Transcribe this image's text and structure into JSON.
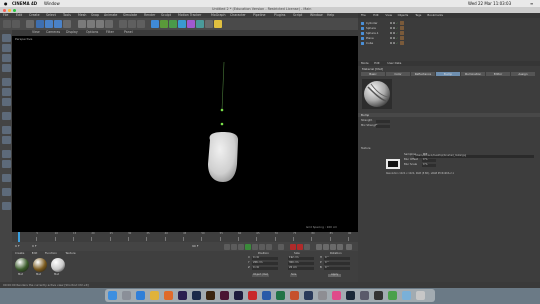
{
  "mac_menubar": {
    "app_name": "CINEMA 4D",
    "menu": "Window",
    "clock": "Wed 22 Mar 11:03:03"
  },
  "window": {
    "title": "Untitled 2 * (Education Version - Restricted License) - Main"
  },
  "app_menu": [
    "File",
    "Edit",
    "Create",
    "Select",
    "Tools",
    "Mesh",
    "Snap",
    "Animate",
    "Simulate",
    "Render",
    "Sculpt",
    "Motion Tracker",
    "MoGraph",
    "Character",
    "Pipeline",
    "Plugins",
    "Script",
    "Window",
    "Help"
  ],
  "layout": {
    "label": "Layout:",
    "value": "Startup (User)"
  },
  "viewport": {
    "menus": [
      "View",
      "Cameras",
      "Display",
      "Options",
      "Filter",
      "Panel"
    ],
    "label": "Perspective",
    "grid_spacing": "Grid Spacing : 100 cm"
  },
  "tooltip": {
    "title": "Render View",
    "line1": "Renders the currently active view",
    "line2": "(Shortcut Ctrl+R)"
  },
  "timeline": {
    "ticks": [
      "0",
      "5",
      "10",
      "15",
      "20",
      "25",
      "30",
      "35",
      "40",
      "45",
      "50",
      "55",
      "60",
      "65",
      "70",
      "75",
      "80",
      "85",
      "90"
    ],
    "frame_start": "0 F",
    "frame_end": "90 F",
    "current": "0 F"
  },
  "material_manager": {
    "menus": [
      "Create",
      "Edit",
      "Function",
      "Texture"
    ],
    "materials": [
      {
        "name": "Mat",
        "color": "#3b5b2b"
      },
      {
        "name": "Mat",
        "color": "#7a5a1e"
      },
      {
        "name": "Mat",
        "color": "#c9c9c9"
      }
    ]
  },
  "coordinates": {
    "headers": [
      "Position",
      "Size",
      "Rotation"
    ],
    "rows": [
      {
        "axis": "X",
        "pos": "0 cm",
        "size": "192 cm",
        "rot_label": "H",
        "rot": "0 °"
      },
      {
        "axis": "Y",
        "pos": "206 cm",
        "size": "300 cm",
        "rot_label": "P",
        "rot": "0 °"
      },
      {
        "axis": "Z",
        "pos": "0 cm",
        "size": "20 cm",
        "rot_label": "B",
        "rot": "0 °"
      }
    ],
    "mode": "Object (Rel)",
    "size_mode": "Size",
    "apply": "Apply"
  },
  "object_manager": {
    "menus": [
      "File",
      "Edit",
      "View",
      "Objects",
      "Tags",
      "Bookmarks"
    ],
    "objects": [
      "Cylinder",
      "Sphere",
      "Sphere.1",
      "Plane",
      "Cube"
    ]
  },
  "attribute_manager": {
    "menus": [
      "Mode",
      "Edit",
      "User Data"
    ],
    "title": "Material [Mat]",
    "tabs": [
      "Basic",
      "Color",
      "Reflectance",
      "Bump",
      "Illumination",
      "Editor",
      "Assign"
    ],
    "section": "Bump",
    "props": [
      "Strength",
      "Mix Strength",
      "Texture",
      "Sampling",
      "Blur Offset",
      "Blur Scale"
    ],
    "sampling_value": "MIP",
    "blur_offset": "0 %",
    "blur_scale": "0 %",
    "texture_path": "/Users/student/Desktop/brushed_metal.jpg",
    "resolution": "Resolution 1024 x 1024, RGB (8 Bit), sRGB IEC61966-2.1"
  },
  "status_text": "00:00:00  Renders the currently active view [Shortcut Ctrl+R]",
  "dock_apps": [
    {
      "name": "finder",
      "color": "#3d8fe0"
    },
    {
      "name": "launchpad",
      "color": "#8a8f98"
    },
    {
      "name": "safari",
      "color": "#2f7fd8"
    },
    {
      "name": "chrome",
      "color": "#e0b23a"
    },
    {
      "name": "firefox",
      "color": "#e06a2a"
    },
    {
      "name": "premiere",
      "color": "#2b1e4f"
    },
    {
      "name": "photoshop",
      "color": "#1b2a4a"
    },
    {
      "name": "illustrator",
      "color": "#3a2410"
    },
    {
      "name": "indesign",
      "color": "#4a1433"
    },
    {
      "name": "after-effects",
      "color": "#1f1c3d"
    },
    {
      "name": "acrobat",
      "color": "#c8282a"
    },
    {
      "name": "word",
      "color": "#2a5aa8"
    },
    {
      "name": "excel",
      "color": "#217346"
    },
    {
      "name": "powerpoint",
      "color": "#c6502c"
    },
    {
      "name": "cinema4d",
      "color": "#2a3a5a"
    },
    {
      "name": "system-prefs",
      "color": "#8e8e93"
    },
    {
      "name": "itunes",
      "color": "#e04a8a"
    },
    {
      "name": "steam",
      "color": "#1b2838"
    },
    {
      "name": "quicktime",
      "color": "#5a5a6a"
    },
    {
      "name": "unity",
      "color": "#333333"
    },
    {
      "name": "maps",
      "color": "#4aa04a"
    },
    {
      "name": "preview",
      "color": "#7ab0d8"
    },
    {
      "name": "trash",
      "color": "#c7c7c7"
    }
  ]
}
